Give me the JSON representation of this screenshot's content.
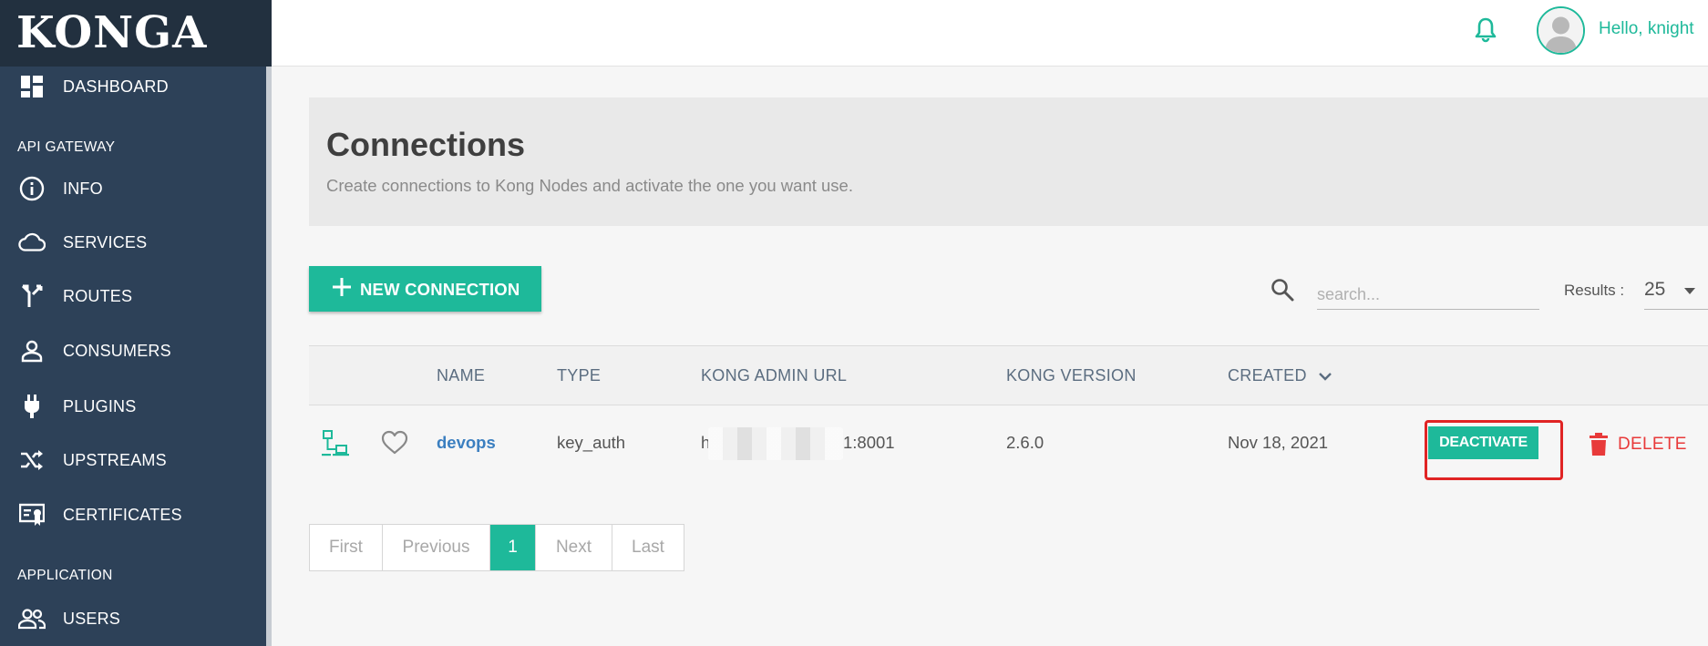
{
  "app": {
    "logo_text": "KONGA"
  },
  "header": {
    "greeting": "Hello, knight"
  },
  "sidebar": {
    "items": [
      {
        "label": "DASHBOARD",
        "icon": "dashboard-icon"
      },
      {
        "label": "INFO",
        "icon": "info-icon"
      },
      {
        "label": "SERVICES",
        "icon": "cloud-icon"
      },
      {
        "label": "ROUTES",
        "icon": "routes-icon"
      },
      {
        "label": "CONSUMERS",
        "icon": "user-icon"
      },
      {
        "label": "PLUGINS",
        "icon": "plug-icon"
      },
      {
        "label": "UPSTREAMS",
        "icon": "shuffle-icon"
      },
      {
        "label": "CERTIFICATES",
        "icon": "certificate-icon"
      },
      {
        "label": "USERS",
        "icon": "users-icon"
      }
    ],
    "sections": {
      "api_gateway": "API GATEWAY",
      "application": "APPLICATION"
    }
  },
  "main": {
    "title": "Connections",
    "subtitle": "Create connections to Kong Nodes and activate the one you want use.",
    "new_button_label": "NEW CONNECTION",
    "search_placeholder": "search...",
    "results_label": "Results :",
    "results_value": "25",
    "table": {
      "columns": [
        "NAME",
        "TYPE",
        "KONG ADMIN URL",
        "KONG VERSION",
        "CREATED"
      ],
      "sort_column": "CREATED",
      "rows": [
        {
          "name": "devops",
          "type": "key_auth",
          "url_prefix": "h",
          "url_suffix": "1:8001",
          "kong_version": "2.6.0",
          "created": "Nov 18, 2021",
          "deactivate_label": "DEACTIVATE",
          "delete_label": "DELETE"
        }
      ]
    },
    "pagination": {
      "items": [
        "First",
        "Previous",
        "1",
        "Next",
        "Last"
      ],
      "active": "1"
    }
  },
  "colors": {
    "accent": "#1eb99a",
    "sidebar": "#2d4158",
    "logo_bar": "#22303f",
    "danger": "#e83a3a",
    "highlight": "#e02424",
    "link": "#3b7fc0"
  }
}
